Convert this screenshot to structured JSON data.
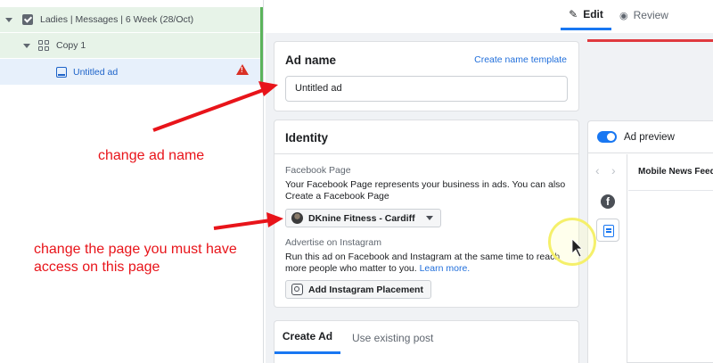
{
  "tree": {
    "campaign_label": "Ladies | Messages | 6 Week (28/Oct)",
    "adset_label": "Copy 1",
    "ad_label": "Untitled ad"
  },
  "tabs": {
    "edit_label": "Edit",
    "review_label": "Review"
  },
  "ad_name_section": {
    "title": "Ad name",
    "template_link": "Create name template",
    "input_value": "Untitled ad"
  },
  "identity_section": {
    "title": "Identity",
    "facebook_page_label": "Facebook Page",
    "facebook_page_help": "Your Facebook Page represents your business in ads. You can also",
    "create_page_link": "Create a Facebook Page",
    "selected_page": "DKnine Fitness - Cardiff",
    "instagram_label": "Advertise on Instagram",
    "instagram_help": "Run this ad on Facebook and Instagram at the same time to reach more people who matter to you.",
    "learn_more_link": "Learn more.",
    "add_instagram_button": "Add Instagram Placement"
  },
  "create_section": {
    "tab_create": "Create Ad",
    "tab_existing": "Use existing post"
  },
  "preview": {
    "title": "Ad preview",
    "placement": "Mobile News Feed",
    "toggle_on": true
  },
  "annotations": {
    "change_name": "change ad name",
    "change_page_line1": "change the page you must have",
    "change_page_line2": "access on this page"
  },
  "colors": {
    "accent": "#1877f2",
    "link": "#216fdb",
    "annotation": "#e8141a",
    "warning": "#d93025",
    "tree_selected": "#e7f0fb",
    "tree_parent": "#e7f3e8"
  },
  "icons": {
    "campaign": "checkbox-icon",
    "adset": "grid-icon",
    "ad": "ad-icon",
    "warning": "warning-icon",
    "edit": "pencil-icon",
    "review": "eye-icon",
    "facebook": "facebook-icon",
    "instagram": "instagram-icon",
    "feed": "mobile-feed-icon"
  }
}
